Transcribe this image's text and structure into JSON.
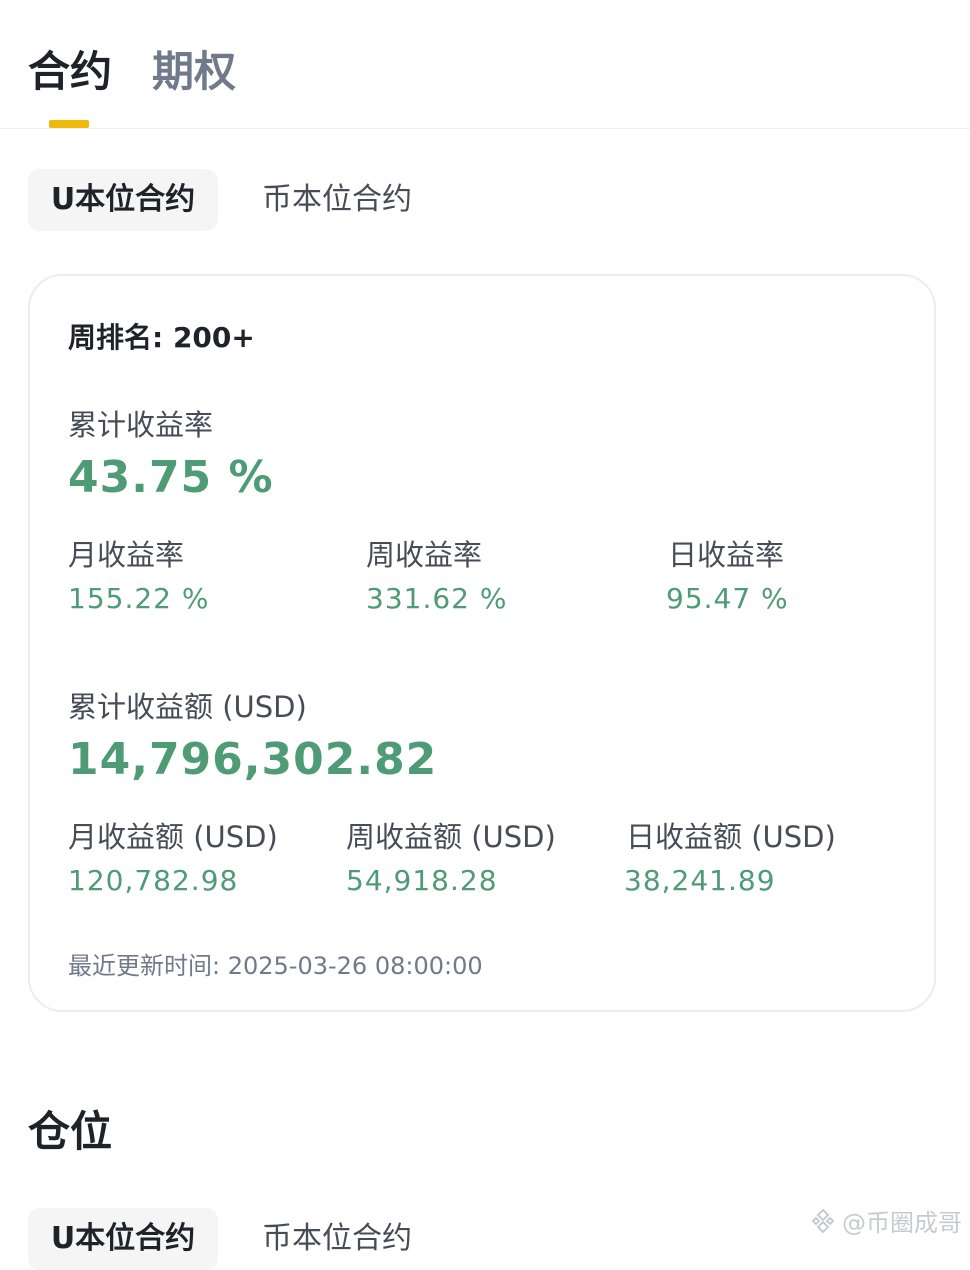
{
  "top_tabs": [
    {
      "label": "合约",
      "active": true
    },
    {
      "label": "期权",
      "active": false
    }
  ],
  "segment_1": {
    "active_label": "U本位合约",
    "inactive_label": "币本位合约"
  },
  "card": {
    "rank_text": "周排名: 200+",
    "cumulative_rate_label": "累计收益率",
    "cumulative_rate_value": "43.75 %",
    "monthly_rate_label": "月收益率",
    "monthly_rate_value": "155.22 %",
    "weekly_rate_label": "周收益率",
    "weekly_rate_value": "331.62 %",
    "daily_rate_label": "日收益率",
    "daily_rate_value": "95.47 %",
    "cumulative_amount_label": "累计收益额 (USD)",
    "cumulative_amount_value": "14,796,302.82",
    "monthly_amount_label": "月收益额 (USD)",
    "monthly_amount_value": "120,782.98",
    "weekly_amount_label": "周收益额 (USD)",
    "weekly_amount_value": "54,918.28",
    "daily_amount_label": "日收益额 (USD)",
    "daily_amount_value": "38,241.89",
    "updated_text": "最近更新时间: 2025-03-26 08:00:00"
  },
  "positions": {
    "title": "仓位"
  },
  "segment_2": {
    "active_label": "U本位合约",
    "inactive_label": "币本位合约"
  },
  "watermark": {
    "text": "@币圈成哥",
    "icon": "binance-logo-icon"
  },
  "colors": {
    "accent": "#f0b90b",
    "positive": "#4f9b76",
    "text_primary": "#1e2329",
    "text_secondary": "#474d57"
  }
}
